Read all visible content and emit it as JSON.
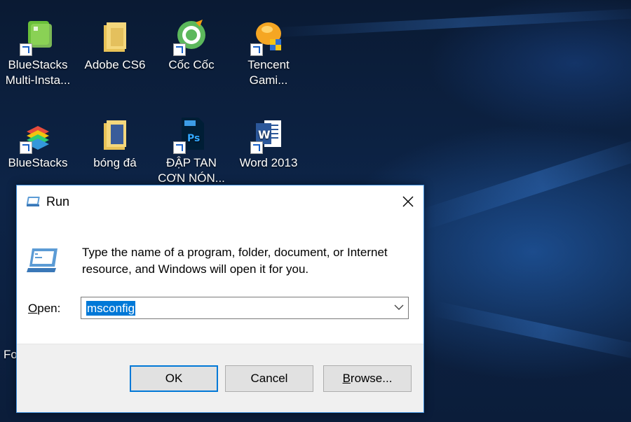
{
  "desktop": {
    "icons": [
      {
        "label_line1": "BlueStacks",
        "label_line2": "Multi-Insta...",
        "icon": "bluestacks-multi-instance-icon"
      },
      {
        "label_line1": "Adobe CS6",
        "label_line2": "",
        "icon": "folder-icon"
      },
      {
        "label_line1": "Cốc Cốc",
        "label_line2": "",
        "icon": "coccoc-browser-icon"
      },
      {
        "label_line1": "Tencent",
        "label_line2": "Gami...",
        "icon": "tencent-gaming-icon"
      },
      {
        "label_line1": "BlueStacks",
        "label_line2": "",
        "icon": "bluestacks-icon"
      },
      {
        "label_line1": "bóng đá",
        "label_line2": "",
        "icon": "folder-icon"
      },
      {
        "label_line1": "ĐẬP TAN",
        "label_line2": "CƠN NÓN...",
        "icon": "photoshop-file-icon"
      },
      {
        "label_line1": "Word 2013",
        "label_line2": "",
        "icon": "word-icon"
      }
    ],
    "partial_label": "Fo"
  },
  "run_dialog": {
    "title": "Run",
    "close_label": "✕",
    "description": "Type the name of a program, folder, document, or Internet resource, and Windows will open it for you.",
    "open_label_underlined": "O",
    "open_label_rest": "pen:",
    "input_value": "msconfig",
    "ok_label": "OK",
    "cancel_label": "Cancel",
    "browse_label_underlined": "B",
    "browse_label_rest": "rowse...",
    "colors": {
      "accent": "#0078d7",
      "footer": "#f0f0f0"
    }
  }
}
